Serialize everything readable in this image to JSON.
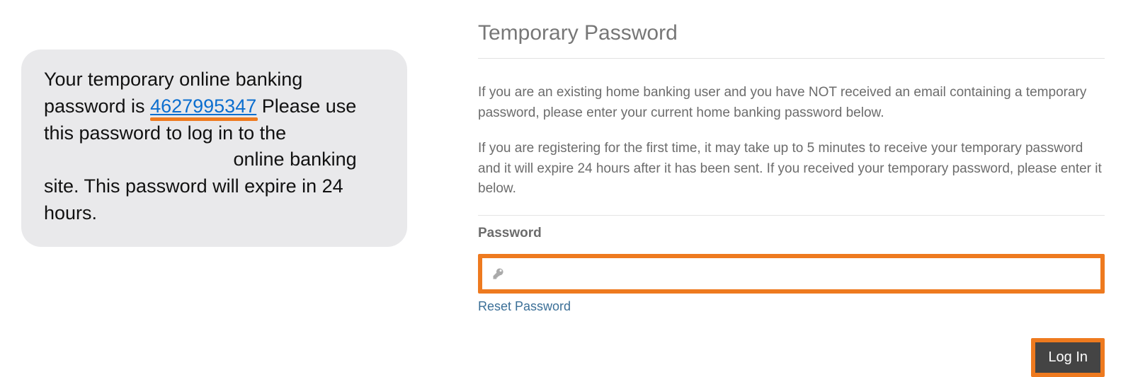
{
  "sms": {
    "part1": "Your temporary online banking password is ",
    "code": "4627995347",
    "part2": " Please use this password to log in to the ",
    "part3": " online banking site. This password will expire in 24 hours."
  },
  "right": {
    "title": "Temporary Password",
    "para1": "If you are an existing home banking user and you have NOT received an email containing a temporary password, please enter your current home banking password below.",
    "para2": "If you are registering for the first time, it may take up to 5 minutes to receive your temporary password and it will expire 24 hours after it has been sent. If you received your temporary password, please enter it below.",
    "password_label": "Password",
    "password_value": "",
    "reset_link": "Reset Password",
    "login_button": "Log In"
  },
  "colors": {
    "highlight": "#ee7a1f",
    "link": "#3b6f97"
  }
}
